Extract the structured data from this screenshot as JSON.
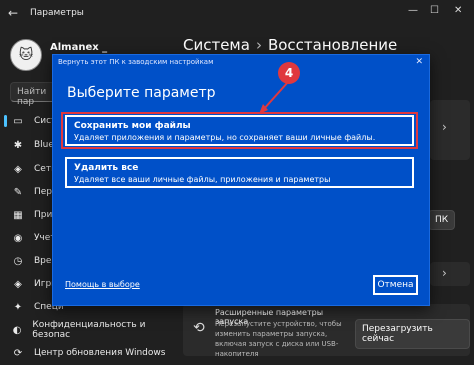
{
  "titlebar": {
    "back": "←",
    "title": "Параметры",
    "minimize": "—",
    "maximize": "☐",
    "close": "✕"
  },
  "sidebar": {
    "user_name": "Almanex _",
    "avatar_glyph": "🐱",
    "search_placeholder": "Найти пар",
    "items": [
      {
        "label": "Систе",
        "icon": "▭"
      },
      {
        "label": "Blue",
        "icon": "✱"
      },
      {
        "label": "Сеть",
        "icon": "◈"
      },
      {
        "label": "Персо",
        "icon": "✎"
      },
      {
        "label": "Прил",
        "icon": "▦"
      },
      {
        "label": "Учет",
        "icon": "◉"
      },
      {
        "label": "Время",
        "icon": "◷"
      },
      {
        "label": "Игры",
        "icon": "◈"
      },
      {
        "label": "Специ",
        "icon": "✦"
      },
      {
        "label": "Конфиденциальность и безопас",
        "icon": "◐"
      },
      {
        "label": "Центр обновления Windows",
        "icon": "⟳"
      }
    ]
  },
  "main": {
    "breadcrumb_parent": "Система",
    "breadcrumb_sep": "›",
    "breadcrumb_current": "Восстановление",
    "bg_right_btn": "ПК",
    "bg_right_chev": "›",
    "bg_right_chev2": "›",
    "advanced_start_title": "Расширенные параметры запуска",
    "advanced_start_desc": "Перезапустите устройство, чтобы изменить параметры запуска, включая запуск с диска или USB-накопителя",
    "restart_btn": "Перезагрузить сейчас"
  },
  "dialog": {
    "title": "Вернуть этот ПК к заводским настройкам",
    "close": "✕",
    "heading": "Выберите параметр",
    "options": [
      {
        "title": "Сохранить мои файлы",
        "desc": "Удаляет приложения и параметры, но сохраняет ваши личные файлы."
      },
      {
        "title": "Удалить все",
        "desc": "Удаляет все ваши личные файлы, приложения и параметры"
      }
    ],
    "help_link": "Помощь в выборе",
    "cancel": "Отмена"
  },
  "annotation": {
    "step": "4"
  },
  "colors": {
    "dialog_bg": "#0050c8",
    "highlight": "#e0383e",
    "accent": "#4cc2ff"
  }
}
